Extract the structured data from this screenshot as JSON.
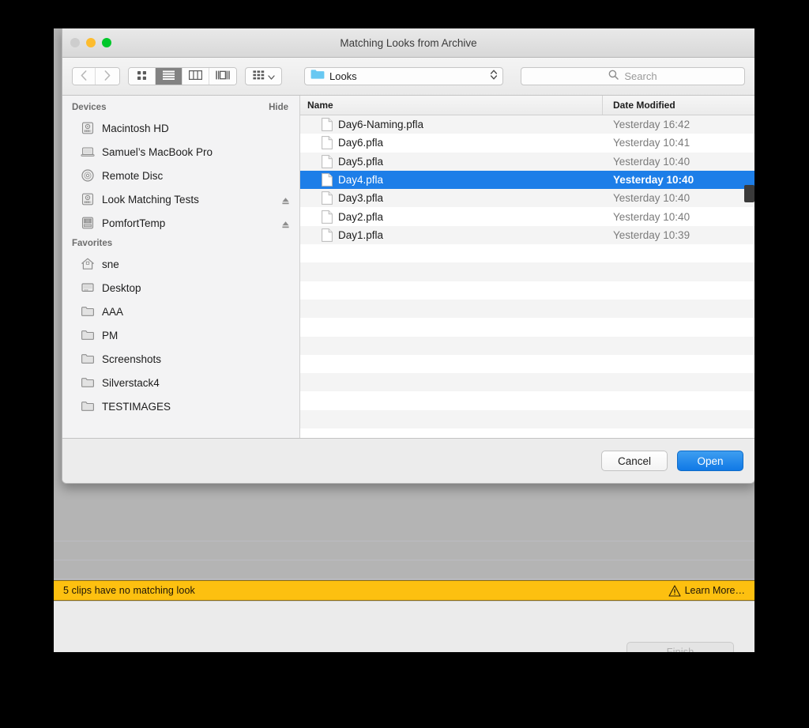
{
  "window": {
    "title": "Matching Looks from Archive",
    "traffic_lights": [
      {
        "name": "close",
        "color": "#cdcdcd"
      },
      {
        "name": "minimize",
        "color": "#fdbc2e"
      },
      {
        "name": "zoom",
        "color": "#00c72a"
      }
    ]
  },
  "toolbar": {
    "back_icon": "chevron-left-icon",
    "forward_icon": "chevron-right-icon",
    "view_modes": [
      {
        "id": "icon",
        "icon": "icon-view-icon",
        "active": false
      },
      {
        "id": "list",
        "icon": "list-view-icon",
        "active": true
      },
      {
        "id": "column",
        "icon": "column-view-icon",
        "active": false
      },
      {
        "id": "gallery",
        "icon": "gallery-view-icon",
        "active": false
      }
    ],
    "arrange": {
      "icon": "arrange-by-icon",
      "chevron": "chevron-down-icon"
    },
    "path_popup": {
      "label": "Looks",
      "icon": "folder-icon",
      "stepper": "up-down-stepper-icon"
    },
    "search": {
      "placeholder": "Search",
      "icon": "search-icon"
    }
  },
  "sidebar": {
    "sections": [
      {
        "title": "Devices",
        "action_label": "Hide",
        "items": [
          {
            "label": "Macintosh HD",
            "icon": "hard-drive-icon",
            "eject": false
          },
          {
            "label": "Samuel’s MacBook Pro",
            "icon": "laptop-icon",
            "eject": false
          },
          {
            "label": "Remote Disc",
            "icon": "optical-disc-icon",
            "eject": false
          },
          {
            "label": "Look Matching Tests",
            "icon": "hard-drive-icon",
            "eject": true
          },
          {
            "label": "PomfortTemp",
            "icon": "external-drive-icon",
            "eject": true
          }
        ]
      },
      {
        "title": "Favorites",
        "action_label": "",
        "items": [
          {
            "label": "sne",
            "icon": "home-icon",
            "eject": false
          },
          {
            "label": "Desktop",
            "icon": "desktop-icon",
            "eject": false
          },
          {
            "label": "AAA",
            "icon": "folder-icon",
            "eject": false
          },
          {
            "label": "PM",
            "icon": "folder-icon",
            "eject": false
          },
          {
            "label": "Screenshots",
            "icon": "folder-icon",
            "eject": false
          },
          {
            "label": "Silverstack4",
            "icon": "folder-icon",
            "eject": false
          },
          {
            "label": "TESTIMAGES",
            "icon": "folder-icon",
            "eject": false
          }
        ]
      }
    ]
  },
  "file_list": {
    "columns": [
      "Name",
      "Date Modified"
    ],
    "rows": [
      {
        "name": "Day6-Naming.pfla",
        "date": "Yesterday 16:42",
        "selected": false
      },
      {
        "name": "Day6.pfla",
        "date": "Yesterday 10:41",
        "selected": false
      },
      {
        "name": "Day5.pfla",
        "date": "Yesterday 10:40",
        "selected": false
      },
      {
        "name": "Day4.pfla",
        "date": "Yesterday 10:40",
        "selected": true
      },
      {
        "name": "Day3.pfla",
        "date": "Yesterday 10:40",
        "selected": false
      },
      {
        "name": "Day2.pfla",
        "date": "Yesterday 10:40",
        "selected": false
      },
      {
        "name": "Day1.pfla",
        "date": "Yesterday 10:39",
        "selected": false
      }
    ],
    "empty_row_count": 11
  },
  "sheet_footer": {
    "cancel_label": "Cancel",
    "open_label": "Open"
  },
  "warning_bar": {
    "message": "5 clips have no matching look",
    "learn_more_label": "Learn More…",
    "icon": "warning-triangle-icon",
    "background": "#fdc010"
  },
  "bottom_bar": {
    "finish_label": "Finish",
    "finish_enabled": false
  },
  "colors": {
    "selection_blue": "#1d7ee8",
    "default_button_blue": "#1079e6",
    "warning_yellow": "#fdc010"
  }
}
